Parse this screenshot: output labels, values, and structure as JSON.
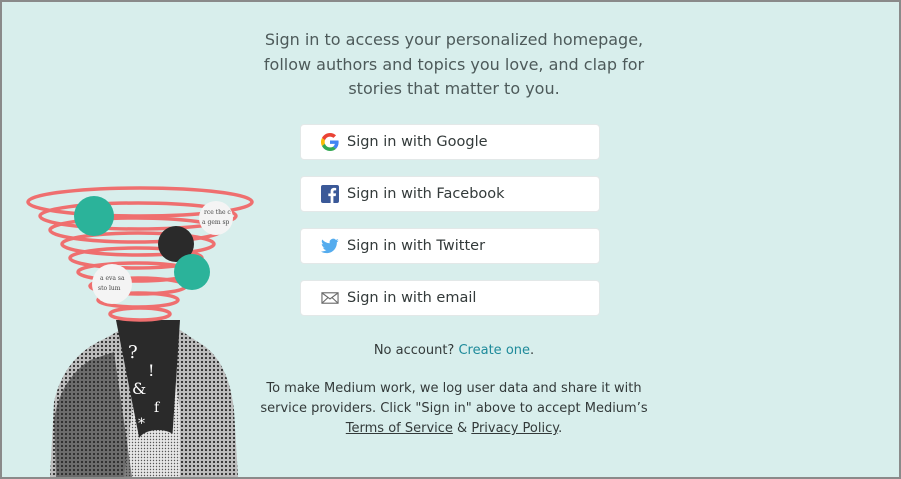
{
  "intro": {
    "line1": "Sign in to access your personalized homepage,",
    "line2": "follow authors and topics you love, and clap for",
    "line3": "stories that matter to you."
  },
  "buttons": {
    "google": {
      "label": "Sign in with Google",
      "icon": "google-icon"
    },
    "facebook": {
      "label": "Sign in with Facebook",
      "icon": "facebook-icon"
    },
    "twitter": {
      "label": "Sign in with Twitter",
      "icon": "twitter-icon"
    },
    "email": {
      "label": "Sign in with email",
      "icon": "mail-icon"
    }
  },
  "account": {
    "prompt": "No account?",
    "link": "Create one",
    "suffix": "."
  },
  "legal": {
    "line1": "To make Medium work, we log user data and share it with",
    "line2": "service providers. Click \"Sign in\" above to accept Medium’s",
    "terms": "Terms of Service",
    "amp": "&",
    "privacy": "Privacy Policy",
    "end": "."
  },
  "colors": {
    "background": "#d8eeec",
    "link": "#1e8a9a",
    "facebook": "#3b5998",
    "twitter": "#55acee"
  }
}
